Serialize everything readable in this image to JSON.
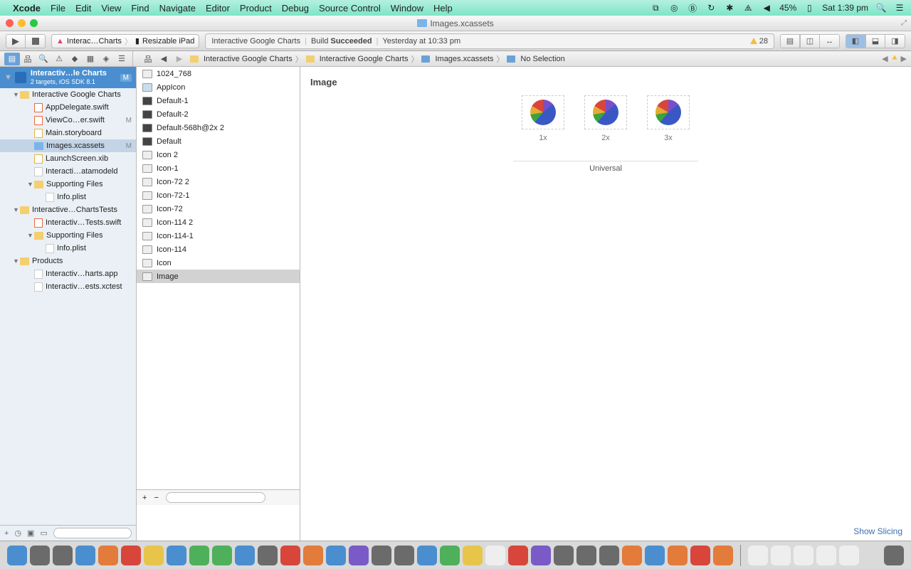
{
  "menubar": {
    "app": "Xcode",
    "items": [
      "File",
      "Edit",
      "View",
      "Find",
      "Navigate",
      "Editor",
      "Product",
      "Debug",
      "Source Control",
      "Window",
      "Help"
    ],
    "battery_pct": "45%",
    "clock": "Sat 1:39 pm"
  },
  "window": {
    "title": "Images.xcassets"
  },
  "toolbar": {
    "scheme_project": "Interac…Charts",
    "scheme_device": "Resizable iPad",
    "activity_project": "Interactive Google Charts",
    "build_label": "Build",
    "build_status": "Succeeded",
    "build_time": "Yesterday at 10:33 pm",
    "warn_count": "28"
  },
  "breadcrumb": {
    "items": [
      "Interactive Google Charts",
      "Interactive Google Charts",
      "Images.xcassets",
      "No Selection"
    ]
  },
  "project": {
    "header_title": "Interactiv…le Charts",
    "header_sub": "2 targets, iOS SDK 8.1",
    "header_badge": "M",
    "tree": [
      {
        "t": "folder",
        "n": "Interactive Google Charts",
        "i": 1,
        "disc": "▼"
      },
      {
        "t": "swift",
        "n": "AppDelegate.swift",
        "i": 2
      },
      {
        "t": "swift",
        "n": "ViewCo…er.swift",
        "i": 2,
        "m": "M"
      },
      {
        "t": "sb",
        "n": "Main.storyboard",
        "i": 2
      },
      {
        "t": "xc",
        "n": "Images.xcassets",
        "i": 2,
        "sel": true,
        "m": "M"
      },
      {
        "t": "sb",
        "n": "LaunchScreen.xib",
        "i": 2
      },
      {
        "t": "file",
        "n": "Interacti…atamodeld",
        "i": 2
      },
      {
        "t": "folder",
        "n": "Supporting Files",
        "i": 2,
        "disc": "▼"
      },
      {
        "t": "file",
        "n": "Info.plist",
        "i": 3
      },
      {
        "t": "folder",
        "n": "Interactive…ChartsTests",
        "i": 1,
        "disc": "▼"
      },
      {
        "t": "swift",
        "n": "Interactiv…Tests.swift",
        "i": 2
      },
      {
        "t": "folder",
        "n": "Supporting Files",
        "i": 2,
        "disc": "▼"
      },
      {
        "t": "file",
        "n": "Info.plist",
        "i": 3
      },
      {
        "t": "folder",
        "n": "Products",
        "i": 1,
        "disc": "▼"
      },
      {
        "t": "file",
        "n": "Interactiv…harts.app",
        "i": 2
      },
      {
        "t": "file",
        "n": "Interactiv…ests.xctest",
        "i": 2
      }
    ]
  },
  "assets": {
    "items": [
      {
        "n": "1024_768",
        "ic": "img"
      },
      {
        "n": "AppIcon",
        "ic": "app"
      },
      {
        "n": "Default-1",
        "ic": "sp"
      },
      {
        "n": "Default-2",
        "ic": "sp"
      },
      {
        "n": "Default-568h@2x 2",
        "ic": "sp"
      },
      {
        "n": "Default",
        "ic": "sp"
      },
      {
        "n": "Icon 2",
        "ic": "img"
      },
      {
        "n": "Icon-1",
        "ic": "img"
      },
      {
        "n": "Icon-72 2",
        "ic": "img"
      },
      {
        "n": "Icon-72-1",
        "ic": "img"
      },
      {
        "n": "Icon-72",
        "ic": "img"
      },
      {
        "n": "Icon-114 2",
        "ic": "img"
      },
      {
        "n": "Icon-114-1",
        "ic": "img"
      },
      {
        "n": "Icon-114",
        "ic": "img"
      },
      {
        "n": "Icon",
        "ic": "img"
      },
      {
        "n": "Image",
        "ic": "img",
        "sel": true
      }
    ]
  },
  "editor": {
    "title": "Image",
    "scales": [
      "1x",
      "2x",
      "3x"
    ],
    "group": "Universal",
    "slicing": "Show Slicing"
  }
}
